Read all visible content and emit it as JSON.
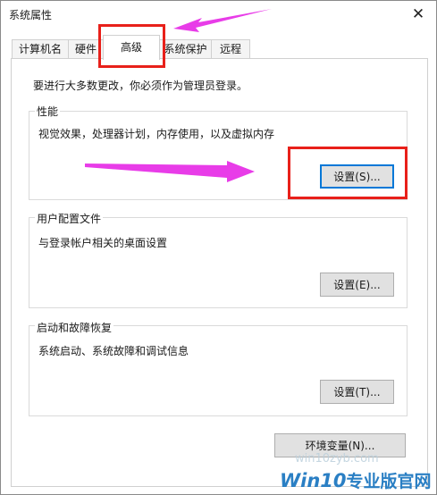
{
  "window": {
    "title": "系统属性",
    "close_symbol": "✕"
  },
  "tabs": [
    {
      "label": "计算机名",
      "active": false
    },
    {
      "label": "硬件",
      "active": false
    },
    {
      "label": "高级",
      "active": true
    },
    {
      "label": "系统保护",
      "active": false
    },
    {
      "label": "远程",
      "active": false
    }
  ],
  "panel": {
    "admin_notice": "要进行大多数更改，你必须作为管理员登录。",
    "performance": {
      "title": "性能",
      "description": "视觉效果，处理器计划，内存使用，以及虚拟内存",
      "button": "设置(S)..."
    },
    "user_profiles": {
      "title": "用户配置文件",
      "description": "与登录帐户相关的桌面设置",
      "button": "设置(E)..."
    },
    "startup_recovery": {
      "title": "启动和故障恢复",
      "description": "系统启动、系统故障和调试信息",
      "button": "设置(T)..."
    },
    "env_button": "环境变量(N)..."
  },
  "watermark": {
    "url": "win10zyb.com",
    "brand_prefix": "Win10",
    "brand_suffix": "专业版官网"
  },
  "colors": {
    "highlight_box": "#e8201a",
    "annotation_arrow": "#e83ce8",
    "focus_border": "#0078d7",
    "brand": "#2a7fc4"
  }
}
